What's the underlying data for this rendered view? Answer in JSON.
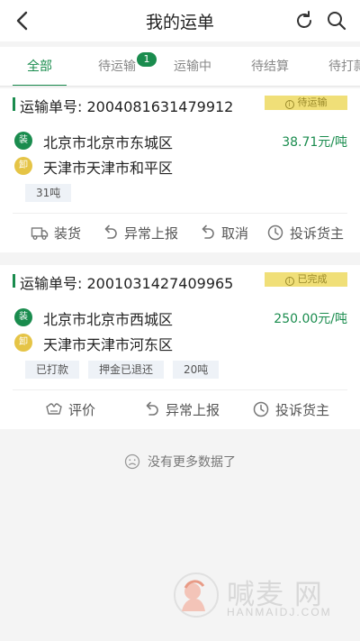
{
  "header": {
    "title": "我的运单",
    "back_icon": "chevron-left-icon",
    "refresh_icon": "refresh-icon",
    "search_icon": "search-icon"
  },
  "tabs": [
    {
      "label": "全部",
      "active": true
    },
    {
      "label": "待运输",
      "badge": "1"
    },
    {
      "label": "运输中"
    },
    {
      "label": "待结算"
    },
    {
      "label": "待打款"
    }
  ],
  "orders": [
    {
      "order_no": "运输单号: 2004081631479912",
      "status": "待运输",
      "load_tag": "装",
      "load_place": "北京市北京市东城区",
      "price": "38.71元/吨",
      "unload_tag": "卸",
      "unload_place": "天津市天津市和平区",
      "tags": [
        "31吨"
      ],
      "actions": [
        "装货",
        "异常上报",
        "取消",
        "投诉货主"
      ]
    },
    {
      "order_no": "运输单号: 2001031427409965",
      "status": "已完成",
      "load_tag": "装",
      "load_place": "北京市北京市西城区",
      "price": "250.00元/吨",
      "unload_tag": "卸",
      "unload_place": "天津市天津市河东区",
      "tags": [
        "已打款",
        "押金已退还",
        "20吨"
      ],
      "actions": [
        "评价",
        "异常上报",
        "投诉货主"
      ]
    }
  ],
  "footer": {
    "no_more": "没有更多数据了"
  },
  "watermark": {
    "text": "喊麦 网",
    "sub": "HANMAIDJ.COM"
  },
  "colors": {
    "accent": "#1a8c4e",
    "status_bg": "#f0df78",
    "unload_dot": "#e5c446"
  }
}
